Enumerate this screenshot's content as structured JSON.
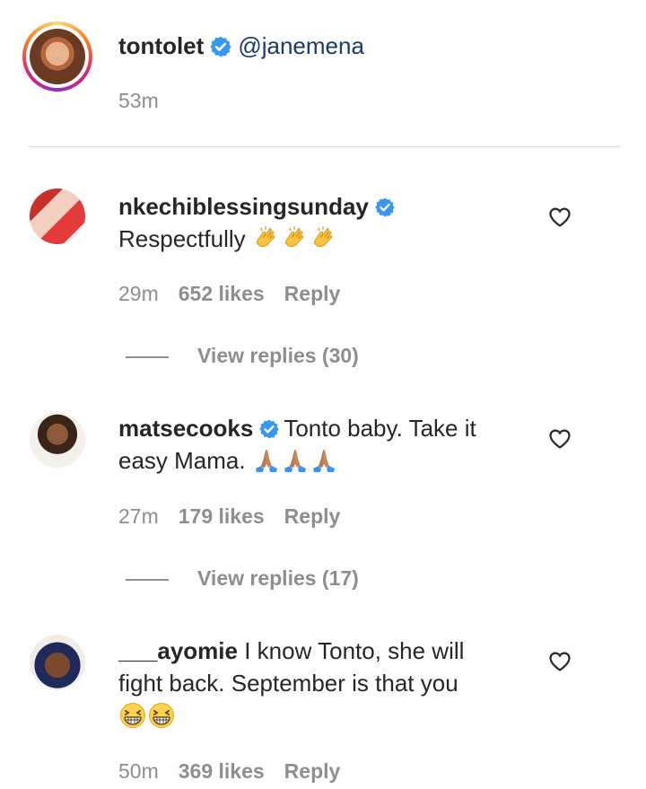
{
  "post": {
    "username": "tontolet",
    "mention": "@janemena",
    "time": "53m"
  },
  "comments": [
    {
      "username": "nkechiblessingsunday",
      "verified": true,
      "text": "Respectfully",
      "emojis": [
        "clapping-hands",
        "clapping-hands",
        "clapping-hands"
      ],
      "time": "29m",
      "likes": "652 likes",
      "reply": "Reply",
      "view_replies": "View replies (30)"
    },
    {
      "username": "matsecooks",
      "verified": true,
      "text": "Tonto baby. Take it easy Mama.",
      "emojis": [
        "folded-hands",
        "folded-hands",
        "folded-hands"
      ],
      "time": "27m",
      "likes": "179 likes",
      "reply": "Reply",
      "view_replies": "View replies (17)"
    },
    {
      "username": "___ayomie",
      "verified": false,
      "text": "I know Tonto, she will fight back. September is that you",
      "emojis": [
        "grinning-squinting-face",
        "grinning-squinting-face"
      ],
      "time": "50m",
      "likes": "369 likes",
      "reply": "Reply"
    }
  ],
  "colors": {
    "verified": "#3897f0",
    "meta": "#8e8e8e",
    "mention": "#1a3a6b"
  }
}
